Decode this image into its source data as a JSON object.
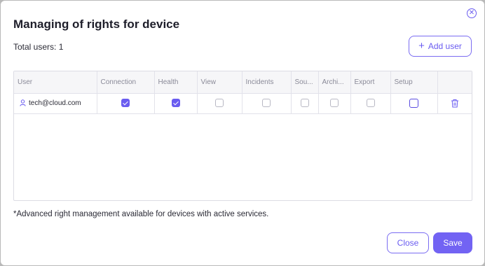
{
  "dialog": {
    "title": "Managing of rights for device",
    "total_users": "Total users: 1",
    "add_user_label": "Add user",
    "footnote": "*Advanced right management available for devices with active services.",
    "close_label": "Close",
    "save_label": "Save"
  },
  "table": {
    "headers": [
      "User",
      "Connection",
      "Health",
      "View",
      "Incidents",
      "Sou...",
      "Archi...",
      "Export",
      "Setup"
    ],
    "rows": [
      {
        "user": "tech@cloud.com",
        "connection": true,
        "health": true,
        "view": false,
        "incidents": false,
        "sources": false,
        "archive": false,
        "export": false,
        "setup": false
      }
    ]
  },
  "colors": {
    "accent": "#6a5cf0",
    "save_button": "#7263f3"
  },
  "icons": {
    "close": "close-circle-icon",
    "add": "plus-icon",
    "user": "user-icon",
    "delete": "trash-icon"
  }
}
